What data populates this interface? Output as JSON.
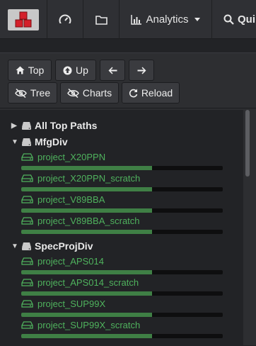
{
  "navbar": {
    "analytics_label": "Analytics",
    "search_label": "Qui"
  },
  "toolbar": {
    "top_label": "Top",
    "up_label": "Up",
    "tree_label": "Tree",
    "charts_label": "Charts",
    "reload_label": "Reload"
  },
  "tree": {
    "all_top_paths": "All Top Paths",
    "groups": [
      {
        "name": "MfgDiv",
        "items": [
          {
            "label": "project_X20PPN",
            "usage": 0.65
          },
          {
            "label": "project_X20PPN_scratch",
            "usage": 0.65
          },
          {
            "label": "project_V89BBA",
            "usage": 0.65
          },
          {
            "label": "project_V89BBA_scratch",
            "usage": 0.65
          }
        ]
      },
      {
        "name": "SpecProjDiv",
        "items": [
          {
            "label": "project_APS014",
            "usage": 0.65
          },
          {
            "label": "project_APS014_scratch",
            "usage": 0.65
          },
          {
            "label": "project_SUP99X",
            "usage": 0.65
          },
          {
            "label": "project_SUP99X_scratch",
            "usage": 0.65
          }
        ]
      }
    ]
  },
  "colors": {
    "accent_green": "#4fb25d",
    "bar_fill": "#3f7f45",
    "logo_red": "#d4202a"
  }
}
